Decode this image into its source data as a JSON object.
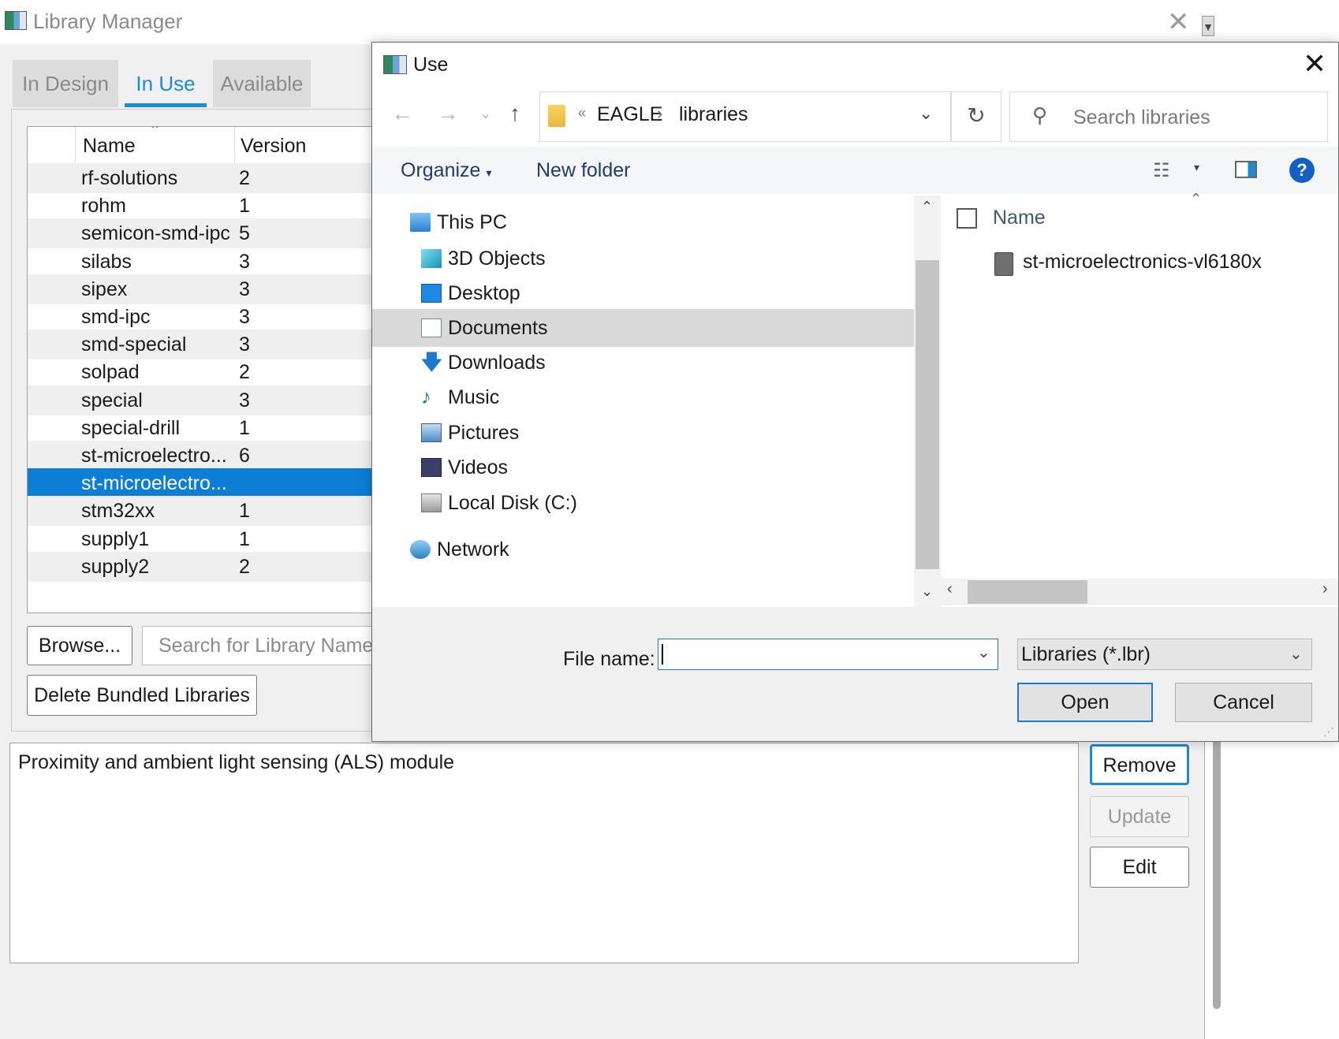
{
  "library_manager": {
    "title": "Library Manager",
    "tabs": [
      "In Design",
      "In Use",
      "Available"
    ],
    "active_tab": "In Use",
    "table": {
      "headers": {
        "name": "Name",
        "version": "Version"
      },
      "rows": [
        {
          "name": "rf-solutions",
          "version": "2"
        },
        {
          "name": "rohm",
          "version": "1"
        },
        {
          "name": "semicon-smd-ipc",
          "version": "5"
        },
        {
          "name": "silabs",
          "version": "3"
        },
        {
          "name": "sipex",
          "version": "3"
        },
        {
          "name": "smd-ipc",
          "version": "3"
        },
        {
          "name": "smd-special",
          "version": "3"
        },
        {
          "name": "solpad",
          "version": "2"
        },
        {
          "name": "special",
          "version": "3"
        },
        {
          "name": "special-drill",
          "version": "1"
        },
        {
          "name": "st-microelectro...",
          "version": "6"
        },
        {
          "name": "st-microelectro...",
          "version": ""
        },
        {
          "name": "stm32xx",
          "version": "1"
        },
        {
          "name": "supply1",
          "version": "1"
        },
        {
          "name": "supply2",
          "version": "2"
        }
      ],
      "selected_index": 11
    },
    "browse_label": "Browse...",
    "search_placeholder": "Search for Library Name",
    "delete_bundled_label": "Delete Bundled Libraries",
    "description": "Proximity and ambient light sensing (ALS) module",
    "buttons": {
      "remove": "Remove",
      "update": "Update",
      "edit": "Edit"
    }
  },
  "dialog": {
    "title": "Use",
    "breadcrumb": [
      "EAGLE",
      "libraries"
    ],
    "breadcrumb_overflow": "«",
    "search_placeholder": "Search libraries",
    "toolbar": {
      "organize": "Organize",
      "new_folder": "New folder"
    },
    "nav_items": [
      {
        "label": "This PC",
        "icon": "computer-icon",
        "level": 0
      },
      {
        "label": "3D Objects",
        "icon": "cube-icon",
        "level": 1
      },
      {
        "label": "Desktop",
        "icon": "desktop-icon",
        "level": 1
      },
      {
        "label": "Documents",
        "icon": "document-icon",
        "level": 1
      },
      {
        "label": "Downloads",
        "icon": "download-arrow-icon",
        "level": 1
      },
      {
        "label": "Music",
        "icon": "music-note-icon",
        "level": 1
      },
      {
        "label": "Pictures",
        "icon": "picture-icon",
        "level": 1
      },
      {
        "label": "Videos",
        "icon": "film-icon",
        "level": 1
      },
      {
        "label": "Local Disk (C:)",
        "icon": "disk-icon",
        "level": 1
      },
      {
        "label": "Network",
        "icon": "network-icon",
        "level": 0
      }
    ],
    "selected_nav": "Documents",
    "file_list": {
      "header": "Name",
      "files": [
        "st-microelectronics-vl6180x"
      ]
    },
    "file_name_label": "File name:",
    "file_name_value": "",
    "file_type": "Libraries (*.lbr)",
    "open_label": "Open",
    "cancel_label": "Cancel"
  }
}
